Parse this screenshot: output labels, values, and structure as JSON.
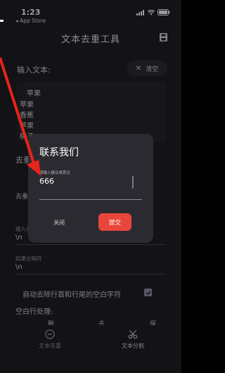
{
  "status": {
    "time": "1:23",
    "back_app": "◂ App Store"
  },
  "nav": {
    "title": "文本去重工具"
  },
  "input": {
    "label": "输入文本:",
    "clear_label": "清空",
    "lines": [
      "苹果",
      "苹果",
      "香蕉",
      "苹果",
      "桃子"
    ]
  },
  "settings": {
    "dedupe_label": "去重",
    "dedupe_mode_label": "去重",
    "input_sep_label": "输入分",
    "input_sep_value": "\\n",
    "output_sep_label": "结果分隔符",
    "output_sep_value": "\\n",
    "trim_label": "自动去除行首和行尾的空白字符",
    "blank_label": "空白行处理:",
    "blank_options": [
      "删",
      "去",
      "保"
    ]
  },
  "tabs": [
    {
      "label": "文本去重",
      "icon": "dedupe-icon",
      "active": true
    },
    {
      "label": "文本分割",
      "icon": "scissors-icon",
      "active": false
    }
  ],
  "dialog": {
    "title": "联系我们",
    "placeholder": "请输入建议或意见",
    "value": "666",
    "cancel_label": "关闭",
    "submit_label": "提交"
  },
  "colors": {
    "accent": "#e8463c",
    "tab_active": "#8e8ba8",
    "annotation_arrow": "#e8231a"
  }
}
